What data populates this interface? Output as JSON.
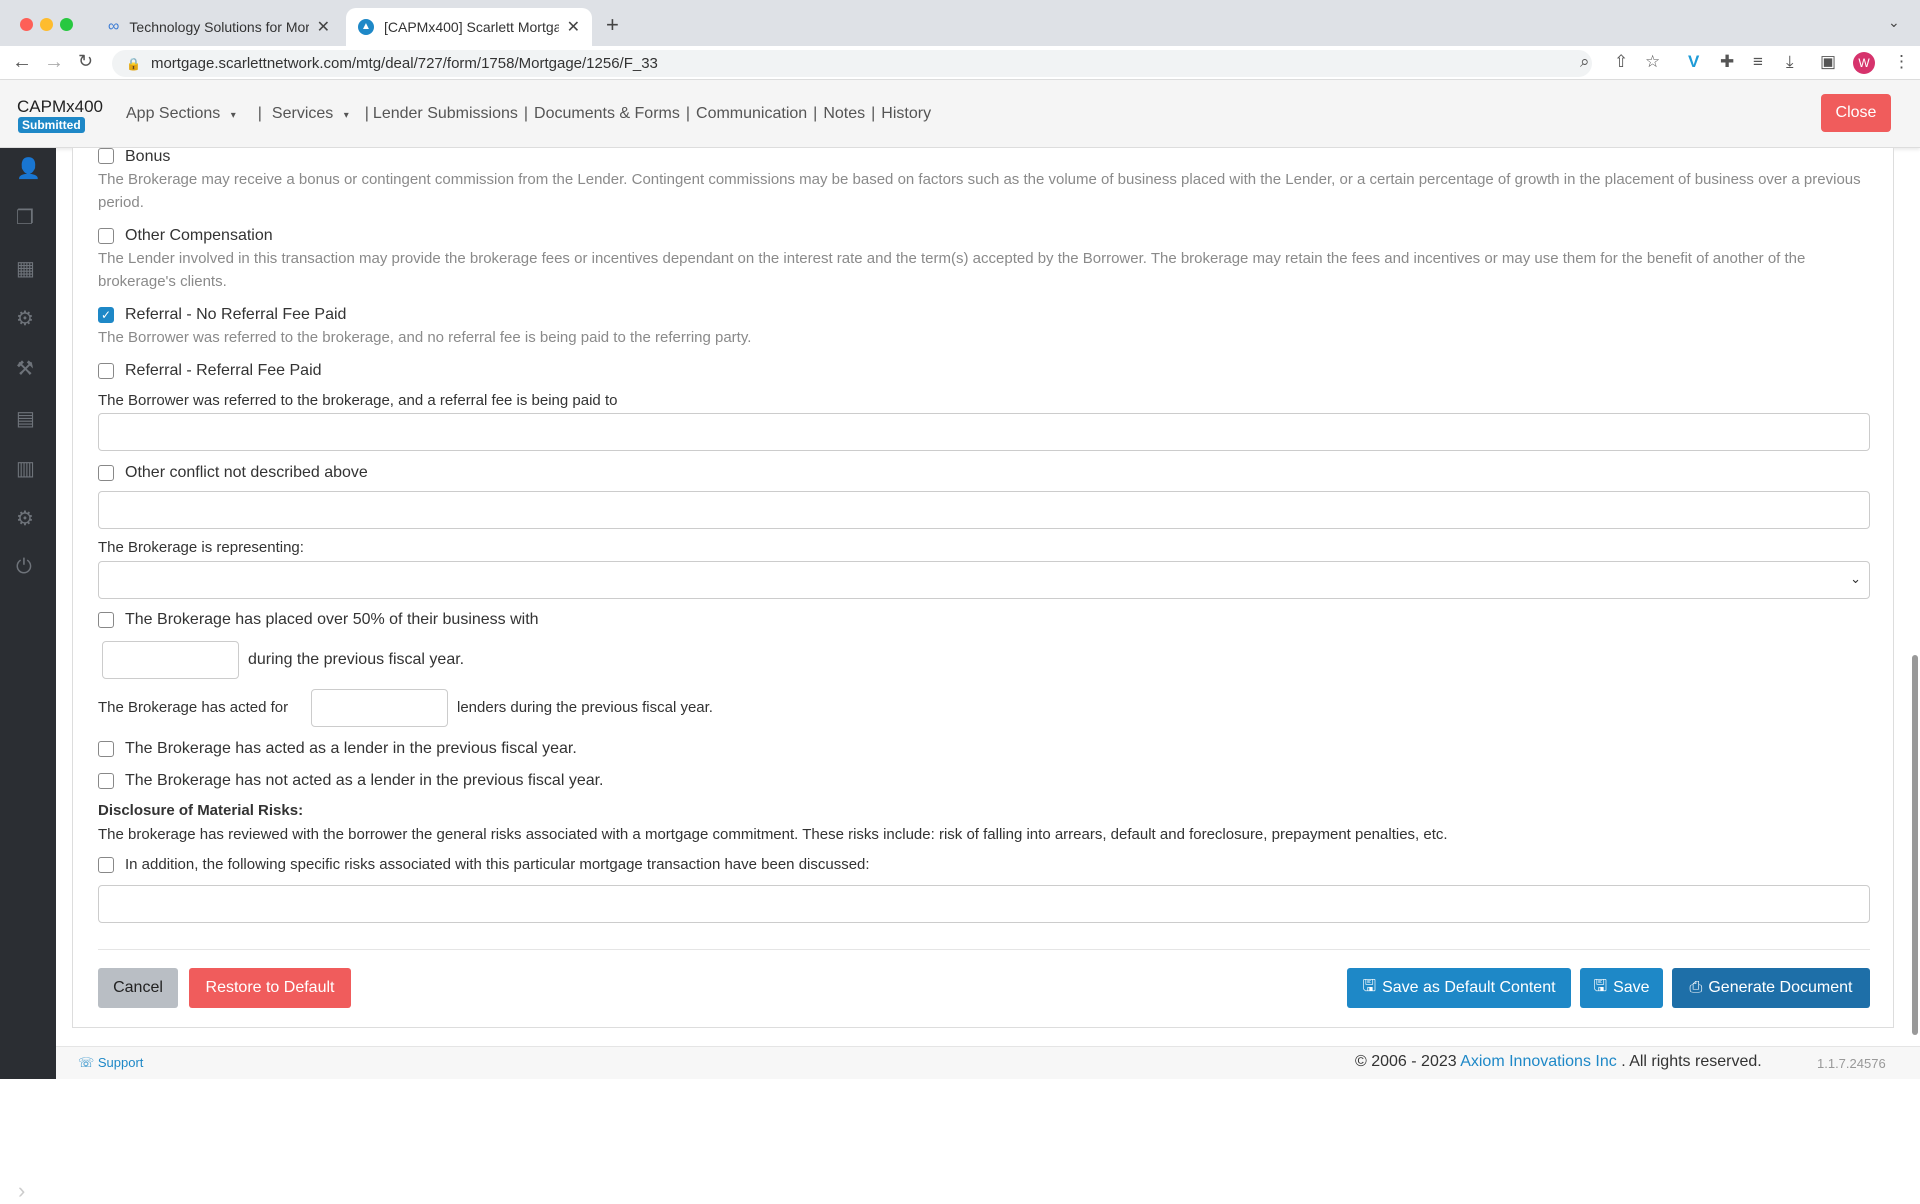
{
  "browser": {
    "tabs": [
      {
        "title": "Technology Solutions for Mortg",
        "icon": "infinity-icon"
      },
      {
        "title": "[CAPMx400] Scarlett Mortgag",
        "icon": "scarlett-logo-icon"
      }
    ],
    "new_tab": "+",
    "url": "mortgage.scarlettnetwork.com/mtg/deal/727/form/1758/Mortgage/1256/F_33",
    "profile_initial": "W"
  },
  "header": {
    "brand": "CAPMx400",
    "status_badge": "Submitted",
    "nav": {
      "app_sections": "App Sections",
      "sep1": "|",
      "services": "Services",
      "sep2": "|",
      "lender_submissions": "Lender Submissions",
      "sep3": "|",
      "documents_forms": "Documents & Forms",
      "sep4": "|",
      "communication": "Communication",
      "sep5": "|",
      "notes": "Notes",
      "sep6": "|",
      "history": "History"
    },
    "close": "Close"
  },
  "form": {
    "bonus": {
      "label": "Bonus",
      "checked": false,
      "desc": "The Brokerage may receive a bonus or contingent commission from the Lender. Contingent commissions may be based on factors such as the volume of business placed with the Lender, or a certain percentage of growth in the placement of business over a previous period."
    },
    "other_comp": {
      "label": "Other Compensation",
      "checked": false,
      "desc": "The Lender involved in this transaction may provide the brokerage fees or incentives dependant on the interest rate and the term(s) accepted by the Borrower. The brokerage may retain the fees and incentives or may use them for the benefit of another of the brokerage's clients."
    },
    "referral_no_fee": {
      "label": "Referral - No Referral Fee Paid",
      "checked": true,
      "desc": "The Borrower was referred to the brokerage, and no referral fee is being paid to the referring party."
    },
    "referral_fee": {
      "label": "Referral - Referral Fee Paid",
      "checked": false,
      "desc": "The Borrower was referred to the brokerage, and a referral fee is being paid to",
      "value": ""
    },
    "other_conflict": {
      "label": "Other conflict not described above",
      "checked": false,
      "value": ""
    },
    "representing": {
      "label": "The Brokerage is representing:",
      "value": ""
    },
    "over50": {
      "label": "The Brokerage has placed over 50% of their business with",
      "checked": false,
      "value": "",
      "suffix": "during the previous fiscal year."
    },
    "acted_for": {
      "prefix": "The Brokerage has acted for",
      "value": "",
      "suffix": "lenders during the previous fiscal year."
    },
    "acted_lender": {
      "label": "The Brokerage has acted as a lender in the previous fiscal year.",
      "checked": false
    },
    "not_acted_lender": {
      "label": "The Brokerage has not acted as a lender in the previous fiscal year.",
      "checked": false
    },
    "risks": {
      "heading": "Disclosure of Material Risks:",
      "text": "The brokerage has reviewed with the borrower the general risks associated with a mortgage commitment. These risks include: risk of falling into arrears, default and foreclosure, prepayment penalties, etc.",
      "specific_label": "In addition, the following specific risks associated with this particular mortgage transaction have been discussed:",
      "checked": false,
      "value": ""
    }
  },
  "actions": {
    "cancel": "Cancel",
    "restore": "Restore to Default",
    "save_default": "Save as Default Content",
    "save": "Save",
    "generate": "Generate Document"
  },
  "footer": {
    "support": "Support",
    "copyright": "© 2006 - 2023",
    "company": "Axiom Innovations Inc",
    "rights": ". All rights reserved.",
    "version": "1.1.7.24576"
  },
  "colors": {
    "primary": "#1e88c7",
    "danger": "#f05c5c",
    "sidebar": "#2b2e33"
  }
}
